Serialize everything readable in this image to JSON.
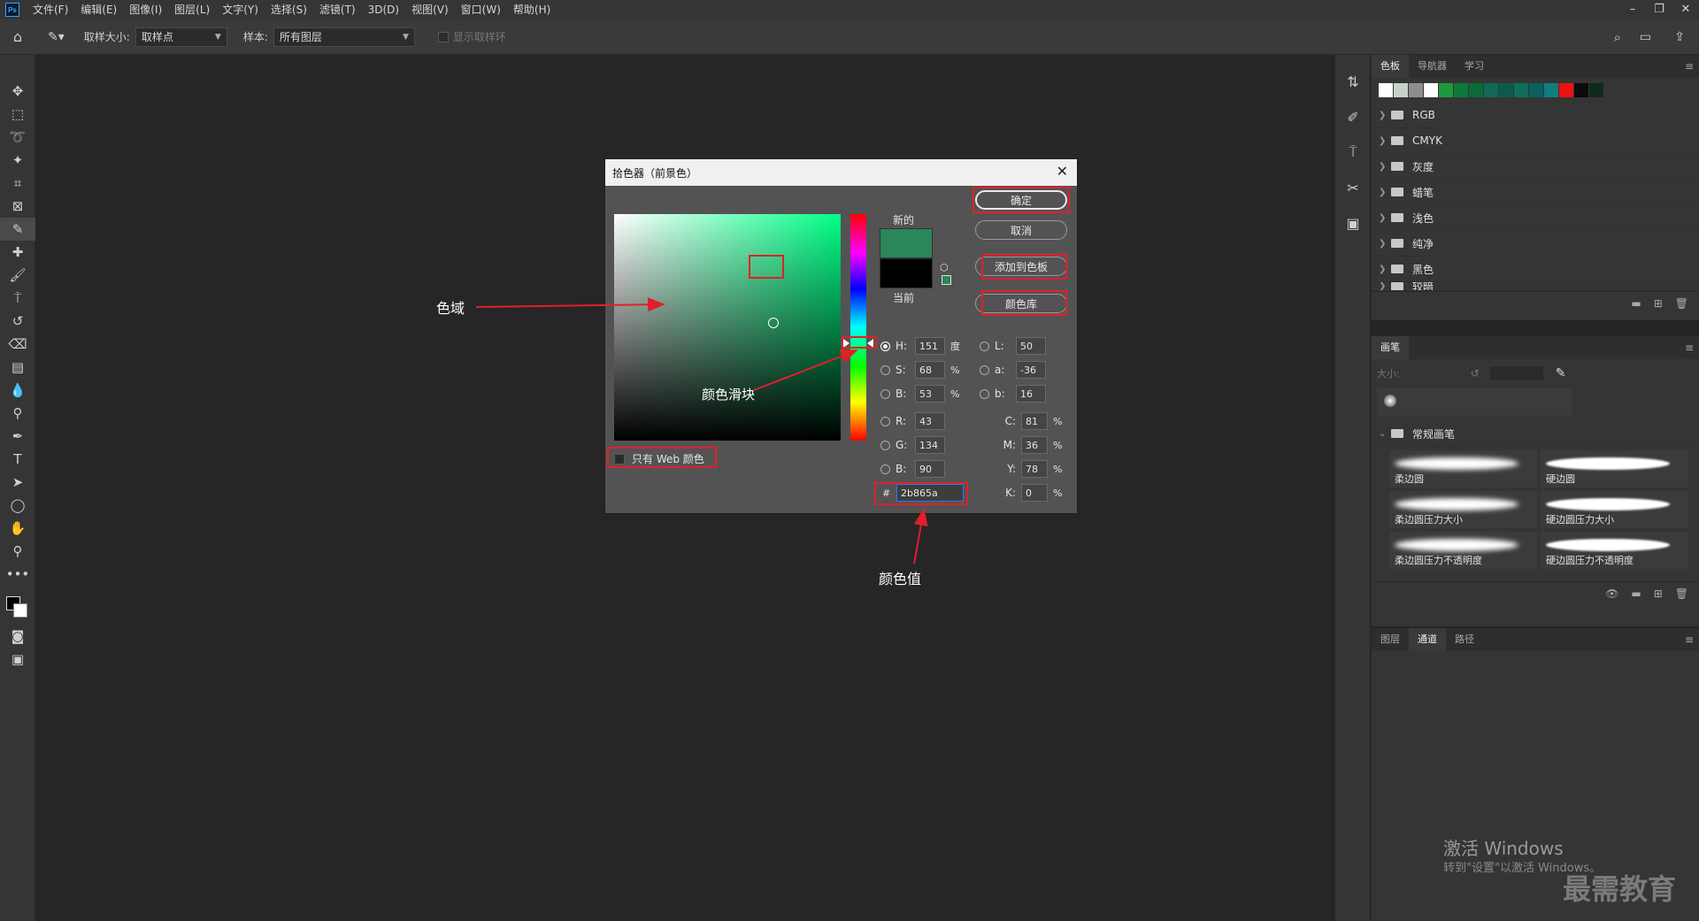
{
  "menubar": {
    "logo": "Ps",
    "items": [
      "文件(F)",
      "编辑(E)",
      "图像(I)",
      "图层(L)",
      "文字(Y)",
      "选择(S)",
      "滤镜(T)",
      "3D(D)",
      "视图(V)",
      "窗口(W)",
      "帮助(H)"
    ]
  },
  "options": {
    "sample_size_label": "取样大小:",
    "sample_size_value": "取样点",
    "sample_label": "样本:",
    "sample_value": "所有图层",
    "show_ring": "显示取样环"
  },
  "dialog": {
    "title": "拾色器（前景色）",
    "new_label": "新的",
    "current_label": "当前",
    "new_color": "#2b865a",
    "current_color": "#000000",
    "buttons": {
      "ok": "确定",
      "cancel": "取消",
      "add_swatch": "添加到色板",
      "libraries": "颜色库"
    },
    "web_only": "只有 Web 颜色",
    "hsb": {
      "H": "151",
      "H_unit": "度",
      "S": "68",
      "S_unit": "%",
      "B": "53",
      "B_unit": "%"
    },
    "rgb": {
      "R": "43",
      "G": "134",
      "B": "90"
    },
    "lab": {
      "L": "50",
      "a": "-36",
      "b": "16"
    },
    "cmyk": {
      "C": "81",
      "M": "36",
      "Y": "78",
      "K": "0",
      "unit": "%"
    },
    "hex_prefix": "#",
    "hex": "2b865a"
  },
  "annotations": {
    "field": "色域",
    "slider": "颜色滑块",
    "value": "颜色值"
  },
  "swatches_panel": {
    "tabs": [
      "色板",
      "导航器",
      "学习"
    ],
    "colors": [
      "#ffffff",
      "#c8d3c8",
      "#8e8e8e",
      "#ffffff",
      "#1c9a3c",
      "#0d7a3a",
      "#0c6a3a",
      "#0f6b55",
      "#0e5a4e",
      "#0f6e5a",
      "#0b5f5e",
      "#0e7f7e",
      "#ee1111",
      "#0b0b0b",
      "#0f2a1a"
    ],
    "groups": [
      "RGB",
      "CMYK",
      "灰度",
      "蜡笔",
      "浅色",
      "纯净",
      "黑色",
      "较暗"
    ]
  },
  "brush_panel": {
    "tab": "画笔",
    "size_label": "大小:",
    "folder": "常规画笔",
    "brushes": [
      "柔边圆",
      "硬边圆",
      "柔边圆压力大小",
      "硬边圆压力大小",
      "柔边圆压力不透明度",
      "硬边圆压力不透明度"
    ]
  },
  "layers_panel": {
    "tabs": [
      "图层",
      "通道",
      "路径"
    ]
  },
  "watermark": {
    "line1": "激活 Windows",
    "line2": "转到\"设置\"以激活 Windows。",
    "brand": "最需教育"
  }
}
